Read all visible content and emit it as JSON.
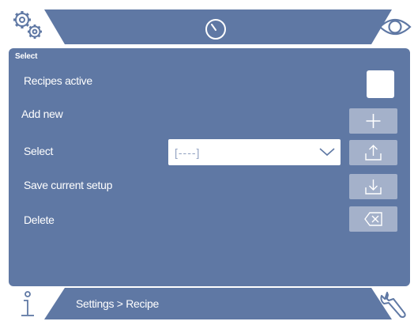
{
  "panel": {
    "title": "Select",
    "rows": {
      "recipes_active": "Recipes active",
      "add_new": "Add new",
      "select": "Select",
      "save_current_setup": "Save current setup",
      "delete": "Delete"
    },
    "recipe_select": {
      "value": "[----]"
    }
  },
  "footer": {
    "breadcrumb": "Settings > Recipe"
  },
  "colors": {
    "bar": "#5f78a4",
    "panel": "#5f78a4",
    "button_disabled": "#a4b1ca",
    "icon_outline": "#5f78a4"
  },
  "icons": {
    "top_left": "gears-icon",
    "top_center": "gauge-icon",
    "top_right": "eye-icon",
    "bottom_left": "info-icon",
    "bottom_right": "wrench-icon"
  }
}
